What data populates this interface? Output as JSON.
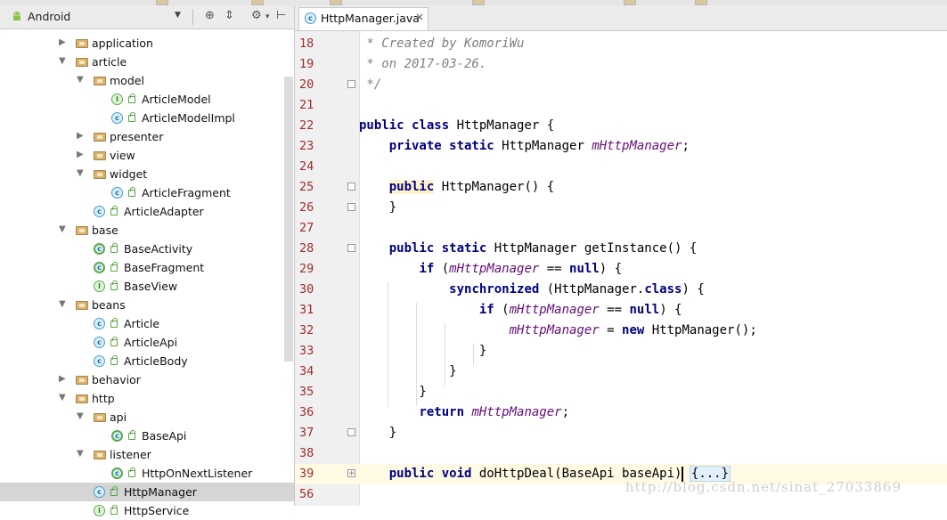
{
  "project_panel": {
    "view_mode": "Android",
    "tree": [
      {
        "label": "application",
        "type": "folder",
        "indent": 0,
        "expanded": false
      },
      {
        "label": "article",
        "type": "folder",
        "indent": 0,
        "expanded": true
      },
      {
        "label": "model",
        "type": "folder",
        "indent": 1,
        "expanded": true
      },
      {
        "label": "ArticleModel",
        "type": "interface",
        "indent": 2
      },
      {
        "label": "ArticleModelImpl",
        "type": "class",
        "indent": 2
      },
      {
        "label": "presenter",
        "type": "folder",
        "indent": 1,
        "expanded": false
      },
      {
        "label": "view",
        "type": "folder",
        "indent": 1,
        "expanded": false
      },
      {
        "label": "widget",
        "type": "folder",
        "indent": 1,
        "expanded": true
      },
      {
        "label": "ArticleFragment",
        "type": "class",
        "indent": 2
      },
      {
        "label": "ArticleAdapter",
        "type": "class",
        "indent": 1
      },
      {
        "label": "base",
        "type": "folder",
        "indent": 0,
        "expanded": true
      },
      {
        "label": "BaseActivity",
        "type": "abstract",
        "indent": 1
      },
      {
        "label": "BaseFragment",
        "type": "abstract",
        "indent": 1
      },
      {
        "label": "BaseView",
        "type": "interface",
        "indent": 1
      },
      {
        "label": "beans",
        "type": "folder",
        "indent": 0,
        "expanded": true
      },
      {
        "label": "Article",
        "type": "class",
        "indent": 1
      },
      {
        "label": "ArticleApi",
        "type": "class",
        "indent": 1
      },
      {
        "label": "ArticleBody",
        "type": "class",
        "indent": 1
      },
      {
        "label": "behavior",
        "type": "folder",
        "indent": 0,
        "expanded": false
      },
      {
        "label": "http",
        "type": "folder",
        "indent": 0,
        "expanded": true
      },
      {
        "label": "api",
        "type": "folder",
        "indent": 1,
        "expanded": true
      },
      {
        "label": "BaseApi",
        "type": "abstract",
        "indent": 2
      },
      {
        "label": "listener",
        "type": "folder",
        "indent": 1,
        "expanded": true
      },
      {
        "label": "HttpOnNextListener",
        "type": "abstract",
        "indent": 2
      },
      {
        "label": "HttpManager",
        "type": "class",
        "indent": 1,
        "selected": true
      },
      {
        "label": "HttpService",
        "type": "interface",
        "indent": 1
      }
    ]
  },
  "editor": {
    "tab_title": "HttpManager.java",
    "lines": [
      {
        "n": "18",
        "segs": [
          [
            "cm",
            " * Created by KomoriWu"
          ]
        ]
      },
      {
        "n": "19",
        "segs": [
          [
            "cm",
            " * on 2017-03-26."
          ]
        ]
      },
      {
        "n": "20",
        "segs": [
          [
            "cm",
            " */"
          ]
        ],
        "fold": "end"
      },
      {
        "n": "21",
        "segs": []
      },
      {
        "n": "22",
        "segs": [
          [
            "kw",
            "public class "
          ],
          [
            "t",
            "HttpManager {"
          ]
        ]
      },
      {
        "n": "23",
        "segs": [
          [
            "t",
            "    "
          ],
          [
            "kw",
            "private static "
          ],
          [
            "t",
            "HttpManager "
          ],
          [
            "fld",
            "mHttpManager"
          ],
          [
            "t",
            ";"
          ]
        ]
      },
      {
        "n": "24",
        "segs": []
      },
      {
        "n": "25",
        "segs": [
          [
            "t",
            "    "
          ],
          [
            "kwhl",
            "public"
          ],
          [
            "t",
            " HttpManager() {"
          ]
        ],
        "fold": "start"
      },
      {
        "n": "26",
        "segs": [
          [
            "t",
            "    }"
          ]
        ],
        "fold": "end"
      },
      {
        "n": "27",
        "segs": []
      },
      {
        "n": "28",
        "segs": [
          [
            "t",
            "    "
          ],
          [
            "kw",
            "public static "
          ],
          [
            "t",
            "HttpManager getInstance() {"
          ]
        ],
        "fold": "start"
      },
      {
        "n": "29",
        "segs": [
          [
            "t",
            "        "
          ],
          [
            "kw",
            "if "
          ],
          [
            "t",
            "("
          ],
          [
            "fld",
            "mHttpManager"
          ],
          [
            "t",
            " == "
          ],
          [
            "kw",
            "null"
          ],
          [
            "t",
            ") {"
          ]
        ]
      },
      {
        "n": "30",
        "segs": [
          [
            "t",
            "            "
          ],
          [
            "kw",
            "synchronized "
          ],
          [
            "t",
            "(HttpManager."
          ],
          [
            "kw",
            "class"
          ],
          [
            "t",
            ") {"
          ]
        ]
      },
      {
        "n": "31",
        "segs": [
          [
            "t",
            "                "
          ],
          [
            "kw",
            "if "
          ],
          [
            "t",
            "("
          ],
          [
            "fld",
            "mHttpManager"
          ],
          [
            "t",
            " == "
          ],
          [
            "kw",
            "null"
          ],
          [
            "t",
            ") {"
          ]
        ]
      },
      {
        "n": "32",
        "segs": [
          [
            "t",
            "                    "
          ],
          [
            "fld",
            "mHttpManager"
          ],
          [
            "t",
            " = "
          ],
          [
            "kw",
            "new "
          ],
          [
            "t",
            "HttpManager();"
          ]
        ]
      },
      {
        "n": "33",
        "segs": [
          [
            "t",
            "                }"
          ]
        ]
      },
      {
        "n": "34",
        "segs": [
          [
            "t",
            "            }"
          ]
        ]
      },
      {
        "n": "35",
        "segs": [
          [
            "t",
            "        }"
          ]
        ]
      },
      {
        "n": "36",
        "segs": [
          [
            "t",
            "        "
          ],
          [
            "kw",
            "return "
          ],
          [
            "fld",
            "mHttpManager"
          ],
          [
            "t",
            ";"
          ]
        ]
      },
      {
        "n": "37",
        "segs": [
          [
            "t",
            "    }"
          ]
        ],
        "fold": "end"
      },
      {
        "n": "38",
        "segs": []
      },
      {
        "n": "39",
        "segs": [
          [
            "t",
            "    "
          ],
          [
            "kw",
            "public void "
          ],
          [
            "t",
            "doHttpDeal(BaseApi baseApi) "
          ],
          [
            "fd",
            "{...}"
          ]
        ],
        "fold": "plus",
        "current": true
      },
      {
        "n": "56",
        "segs": []
      }
    ]
  },
  "watermark": "http://blog.csdn.net/sinat_27033869"
}
